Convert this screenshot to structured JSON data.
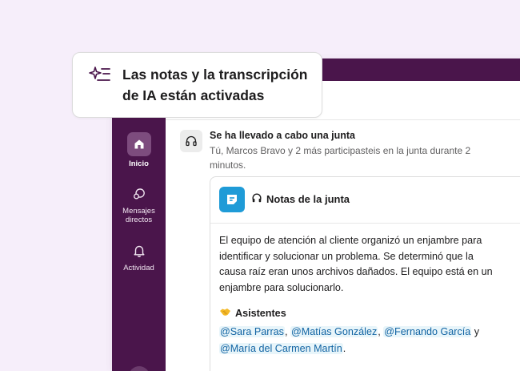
{
  "callout": {
    "icon": "ai-sparkle-list-icon",
    "text": "Las notas y la transcripción de IA están activadas"
  },
  "sidebar": {
    "items": [
      {
        "label": "Inicio",
        "icon": "home-icon",
        "active": true
      },
      {
        "label": "Mensajes directos",
        "icon": "direct-messages-icon"
      },
      {
        "label": "Actividad",
        "icon": "bell-icon"
      }
    ],
    "add_icon": "plus-icon"
  },
  "huddle": {
    "icon": "headphones-icon",
    "title": "Se ha llevado a cabo una junta",
    "subtitle": "Tú, Marcos Bravo y 2 más participasteis en la junta durante 2 minutos."
  },
  "notes": {
    "title": "Notas de la junta",
    "summary": "El equipo de atención al cliente organizó un enjambre para identificar y solucionar un problema. Se determinó que la causa raíz eran unos archivos dañados. El equipo está en un enjambre para solucionarlo.",
    "attendees_heading": "Asistentes",
    "attendees": [
      "@Sara Parras",
      "@Matías González",
      "@Fernando García",
      "@María del Carmen Martín"
    ],
    "sep_comma": ", ",
    "sep_and": " y ",
    "end": "."
  },
  "colors": {
    "sidebar": "#4a154b",
    "background": "#f6eefa",
    "mention": "#1264a3",
    "notes_logo": "#1f9bd7"
  }
}
